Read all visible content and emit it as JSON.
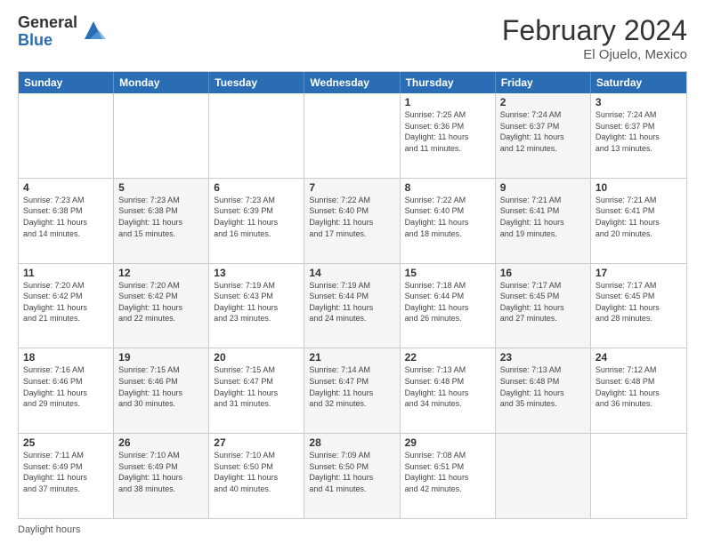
{
  "logo": {
    "general": "General",
    "blue": "Blue"
  },
  "title": "February 2024",
  "subtitle": "El Ojuelo, Mexico",
  "days_header": [
    "Sunday",
    "Monday",
    "Tuesday",
    "Wednesday",
    "Thursday",
    "Friday",
    "Saturday"
  ],
  "footer": "Daylight hours",
  "weeks": [
    [
      {
        "day": "",
        "info": "",
        "shaded": false
      },
      {
        "day": "",
        "info": "",
        "shaded": false
      },
      {
        "day": "",
        "info": "",
        "shaded": false
      },
      {
        "day": "",
        "info": "",
        "shaded": false
      },
      {
        "day": "1",
        "info": "Sunrise: 7:25 AM\nSunset: 6:36 PM\nDaylight: 11 hours\nand 11 minutes.",
        "shaded": false
      },
      {
        "day": "2",
        "info": "Sunrise: 7:24 AM\nSunset: 6:37 PM\nDaylight: 11 hours\nand 12 minutes.",
        "shaded": true
      },
      {
        "day": "3",
        "info": "Sunrise: 7:24 AM\nSunset: 6:37 PM\nDaylight: 11 hours\nand 13 minutes.",
        "shaded": false
      }
    ],
    [
      {
        "day": "4",
        "info": "Sunrise: 7:23 AM\nSunset: 6:38 PM\nDaylight: 11 hours\nand 14 minutes.",
        "shaded": false
      },
      {
        "day": "5",
        "info": "Sunrise: 7:23 AM\nSunset: 6:38 PM\nDaylight: 11 hours\nand 15 minutes.",
        "shaded": true
      },
      {
        "day": "6",
        "info": "Sunrise: 7:23 AM\nSunset: 6:39 PM\nDaylight: 11 hours\nand 16 minutes.",
        "shaded": false
      },
      {
        "day": "7",
        "info": "Sunrise: 7:22 AM\nSunset: 6:40 PM\nDaylight: 11 hours\nand 17 minutes.",
        "shaded": true
      },
      {
        "day": "8",
        "info": "Sunrise: 7:22 AM\nSunset: 6:40 PM\nDaylight: 11 hours\nand 18 minutes.",
        "shaded": false
      },
      {
        "day": "9",
        "info": "Sunrise: 7:21 AM\nSunset: 6:41 PM\nDaylight: 11 hours\nand 19 minutes.",
        "shaded": true
      },
      {
        "day": "10",
        "info": "Sunrise: 7:21 AM\nSunset: 6:41 PM\nDaylight: 11 hours\nand 20 minutes.",
        "shaded": false
      }
    ],
    [
      {
        "day": "11",
        "info": "Sunrise: 7:20 AM\nSunset: 6:42 PM\nDaylight: 11 hours\nand 21 minutes.",
        "shaded": false
      },
      {
        "day": "12",
        "info": "Sunrise: 7:20 AM\nSunset: 6:42 PM\nDaylight: 11 hours\nand 22 minutes.",
        "shaded": true
      },
      {
        "day": "13",
        "info": "Sunrise: 7:19 AM\nSunset: 6:43 PM\nDaylight: 11 hours\nand 23 minutes.",
        "shaded": false
      },
      {
        "day": "14",
        "info": "Sunrise: 7:19 AM\nSunset: 6:44 PM\nDaylight: 11 hours\nand 24 minutes.",
        "shaded": true
      },
      {
        "day": "15",
        "info": "Sunrise: 7:18 AM\nSunset: 6:44 PM\nDaylight: 11 hours\nand 26 minutes.",
        "shaded": false
      },
      {
        "day": "16",
        "info": "Sunrise: 7:17 AM\nSunset: 6:45 PM\nDaylight: 11 hours\nand 27 minutes.",
        "shaded": true
      },
      {
        "day": "17",
        "info": "Sunrise: 7:17 AM\nSunset: 6:45 PM\nDaylight: 11 hours\nand 28 minutes.",
        "shaded": false
      }
    ],
    [
      {
        "day": "18",
        "info": "Sunrise: 7:16 AM\nSunset: 6:46 PM\nDaylight: 11 hours\nand 29 minutes.",
        "shaded": false
      },
      {
        "day": "19",
        "info": "Sunrise: 7:15 AM\nSunset: 6:46 PM\nDaylight: 11 hours\nand 30 minutes.",
        "shaded": true
      },
      {
        "day": "20",
        "info": "Sunrise: 7:15 AM\nSunset: 6:47 PM\nDaylight: 11 hours\nand 31 minutes.",
        "shaded": false
      },
      {
        "day": "21",
        "info": "Sunrise: 7:14 AM\nSunset: 6:47 PM\nDaylight: 11 hours\nand 32 minutes.",
        "shaded": true
      },
      {
        "day": "22",
        "info": "Sunrise: 7:13 AM\nSunset: 6:48 PM\nDaylight: 11 hours\nand 34 minutes.",
        "shaded": false
      },
      {
        "day": "23",
        "info": "Sunrise: 7:13 AM\nSunset: 6:48 PM\nDaylight: 11 hours\nand 35 minutes.",
        "shaded": true
      },
      {
        "day": "24",
        "info": "Sunrise: 7:12 AM\nSunset: 6:48 PM\nDaylight: 11 hours\nand 36 minutes.",
        "shaded": false
      }
    ],
    [
      {
        "day": "25",
        "info": "Sunrise: 7:11 AM\nSunset: 6:49 PM\nDaylight: 11 hours\nand 37 minutes.",
        "shaded": false
      },
      {
        "day": "26",
        "info": "Sunrise: 7:10 AM\nSunset: 6:49 PM\nDaylight: 11 hours\nand 38 minutes.",
        "shaded": true
      },
      {
        "day": "27",
        "info": "Sunrise: 7:10 AM\nSunset: 6:50 PM\nDaylight: 11 hours\nand 40 minutes.",
        "shaded": false
      },
      {
        "day": "28",
        "info": "Sunrise: 7:09 AM\nSunset: 6:50 PM\nDaylight: 11 hours\nand 41 minutes.",
        "shaded": true
      },
      {
        "day": "29",
        "info": "Sunrise: 7:08 AM\nSunset: 6:51 PM\nDaylight: 11 hours\nand 42 minutes.",
        "shaded": false
      },
      {
        "day": "",
        "info": "",
        "shaded": true
      },
      {
        "day": "",
        "info": "",
        "shaded": false
      }
    ]
  ]
}
